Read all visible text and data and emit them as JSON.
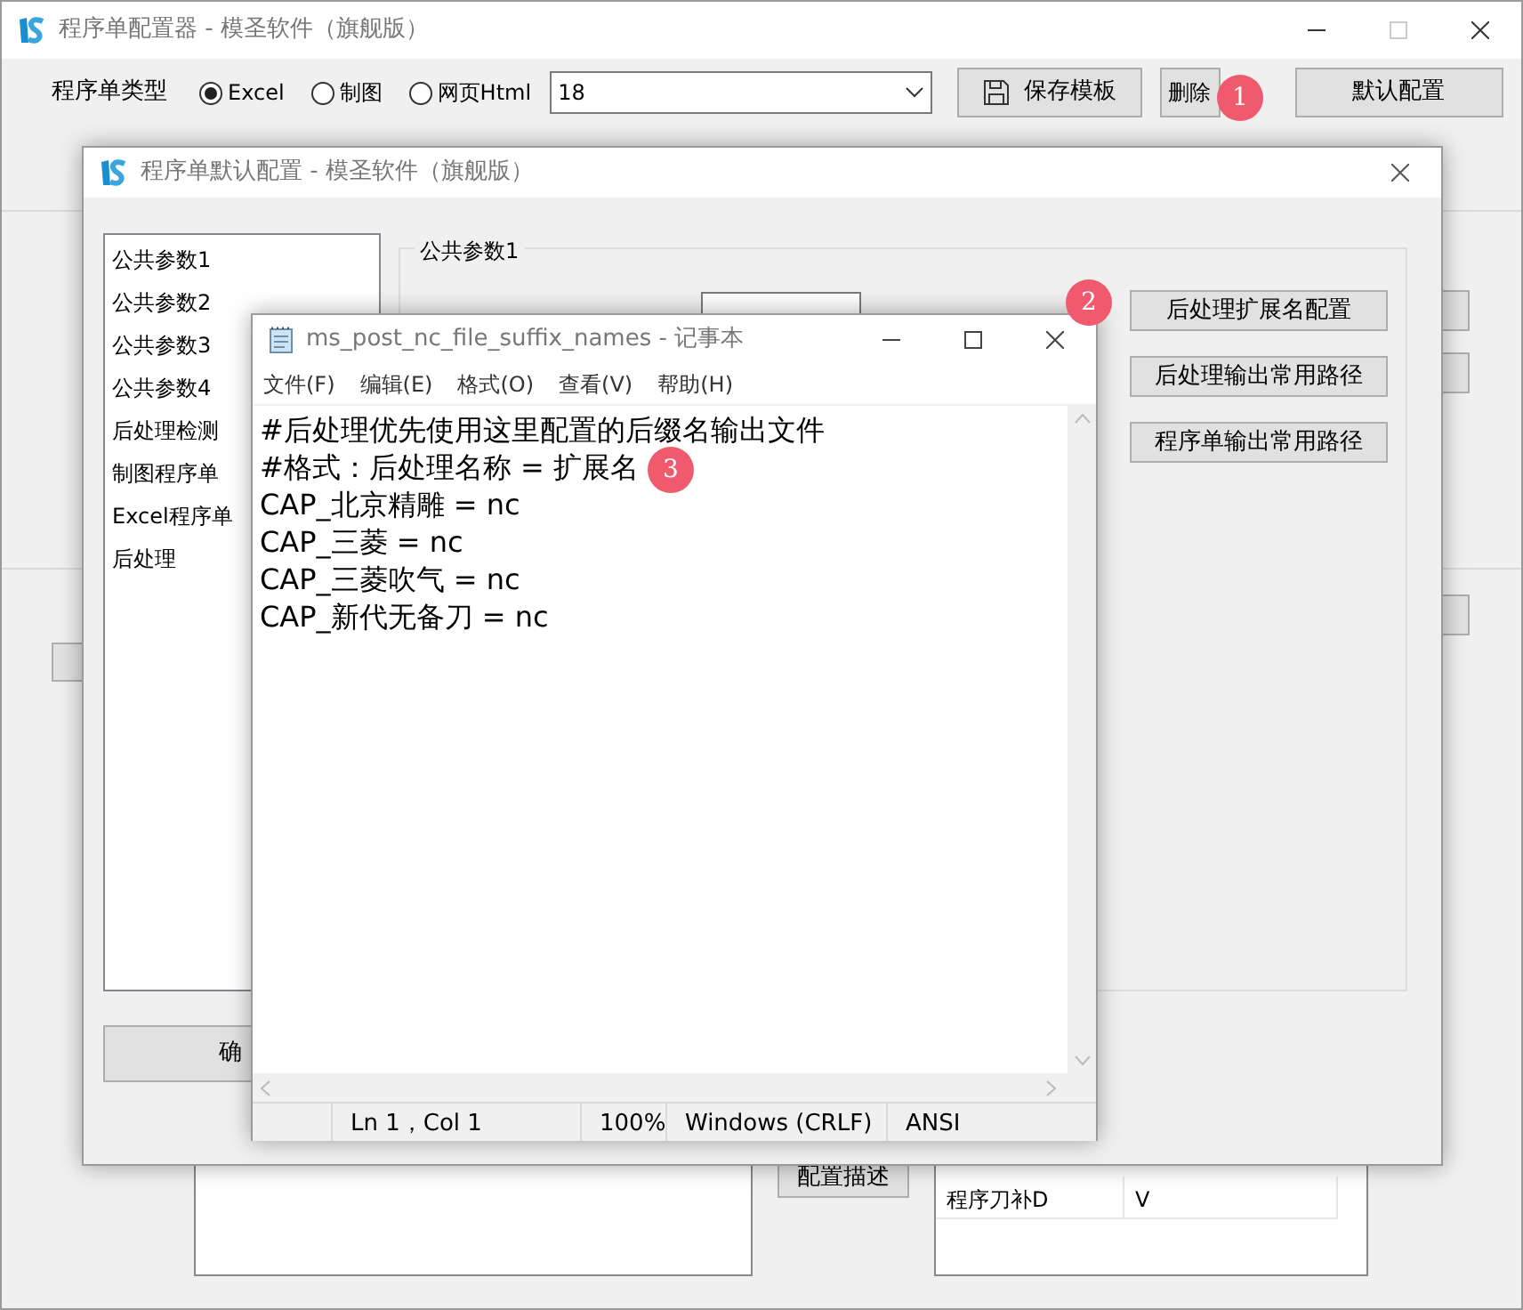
{
  "main_window": {
    "title": "程序单配置器 - 模圣软件（旗舰版）",
    "type_label": "程序单类型",
    "type_options": [
      {
        "label": "Excel",
        "selected": true
      },
      {
        "label": "制图",
        "selected": false
      },
      {
        "label": "网页Html",
        "selected": false
      }
    ],
    "template_select": {
      "value": "18"
    },
    "buttons": [
      {
        "label": "保存模板",
        "kind": "save"
      },
      {
        "label": "删除",
        "kind": "small"
      },
      {
        "label": "默认配置",
        "kind": "wide"
      }
    ],
    "describe_button": "配置描述",
    "right_table": {
      "rows": [
        [
          "程序刀补D",
          "V"
        ]
      ]
    }
  },
  "dialog": {
    "title": "程序单默认配置 - 模圣软件（旗舰版）",
    "nav_items": [
      "公共参数1",
      "公共参数2",
      "公共参数3",
      "公共参数4",
      "后处理检测",
      "制图程序单",
      "Excel程序单",
      "后处理"
    ],
    "group_title": "公共参数1",
    "buttons": [
      "后处理扩展名配置",
      "后处理输出常用路径",
      "程序单输出常用路径"
    ],
    "ok_button": "确"
  },
  "notepad": {
    "title": "ms_post_nc_file_suffix_names - 记事本",
    "menu": [
      "文件(F)",
      "编辑(E)",
      "格式(O)",
      "查看(V)",
      "帮助(H)"
    ],
    "lines": [
      "#后处理优先使用这里配置的后缀名输出文件",
      "#格式：后处理名称 = 扩展名",
      "CAP_北京精雕 = nc",
      "CAP_三菱 = nc",
      "CAP_三菱吹气 = nc",
      "CAP_新代无备刀 = nc"
    ],
    "status_bar": [
      "Ln 1，Col 1",
      "100%",
      "Windows (CRLF)",
      "ANSI"
    ]
  },
  "callouts": [
    "1",
    "2",
    "3"
  ]
}
